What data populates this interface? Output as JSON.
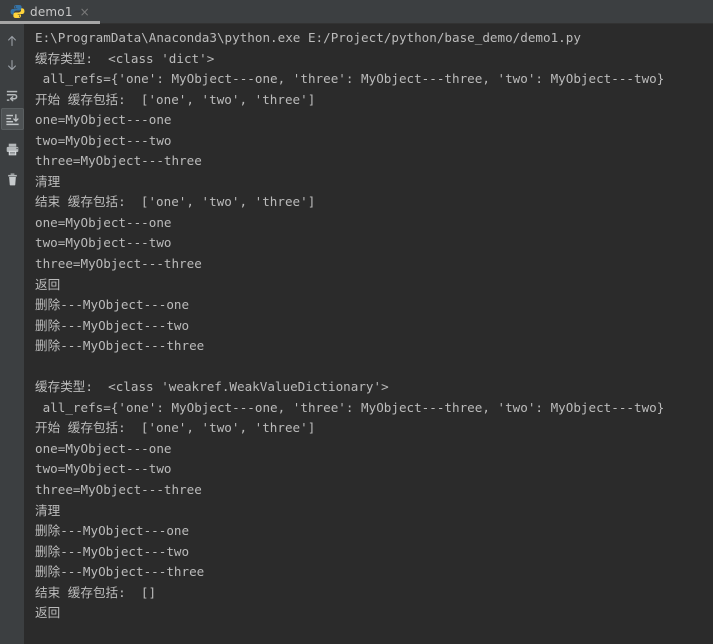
{
  "window": {
    "background_color": "#2b2b2b",
    "chrome_color": "#3c3f41",
    "text_color": "#bbbbbb",
    "active_tab_underline_color": "#a6a6a6"
  },
  "tabbar": {
    "tabs": [
      {
        "label": "demo1",
        "icon": "python-file-icon",
        "close_label": "×",
        "active": true
      }
    ]
  },
  "toolbar": {
    "buttons": [
      {
        "name": "up-arrow-icon",
        "tooltip": "Up the Stack Trace",
        "selected": false
      },
      {
        "name": "down-arrow-icon",
        "tooltip": "Down the Stack Trace",
        "selected": false
      },
      {
        "name": "soft-wrap-icon",
        "tooltip": "Use Soft Wraps",
        "selected": false
      },
      {
        "name": "scroll-to-end-icon",
        "tooltip": "Scroll to End",
        "selected": true
      },
      {
        "name": "print-icon",
        "tooltip": "Print",
        "selected": false
      },
      {
        "name": "trash-icon",
        "tooltip": "Clear All",
        "selected": false
      }
    ]
  },
  "console": {
    "lines": [
      "E:\\ProgramData\\Anaconda3\\python.exe E:/Project/python/base_demo/demo1.py",
      "缓存类型:  <class 'dict'>",
      " all_refs={'one': MyObject---one, 'three': MyObject---three, 'two': MyObject---two}",
      "开始 缓存包括:  ['one', 'two', 'three']",
      "one=MyObject---one",
      "two=MyObject---two",
      "three=MyObject---three",
      "清理",
      "结束 缓存包括:  ['one', 'two', 'three']",
      "one=MyObject---one",
      "two=MyObject---two",
      "three=MyObject---three",
      "返回",
      "删除---MyObject---one",
      "删除---MyObject---two",
      "删除---MyObject---three",
      "",
      "缓存类型:  <class 'weakref.WeakValueDictionary'>",
      " all_refs={'one': MyObject---one, 'three': MyObject---three, 'two': MyObject---two}",
      "开始 缓存包括:  ['one', 'two', 'three']",
      "one=MyObject---one",
      "two=MyObject---two",
      "three=MyObject---three",
      "清理",
      "删除---MyObject---one",
      "删除---MyObject---two",
      "删除---MyObject---three",
      "结束 缓存包括:  []",
      "返回"
    ]
  }
}
